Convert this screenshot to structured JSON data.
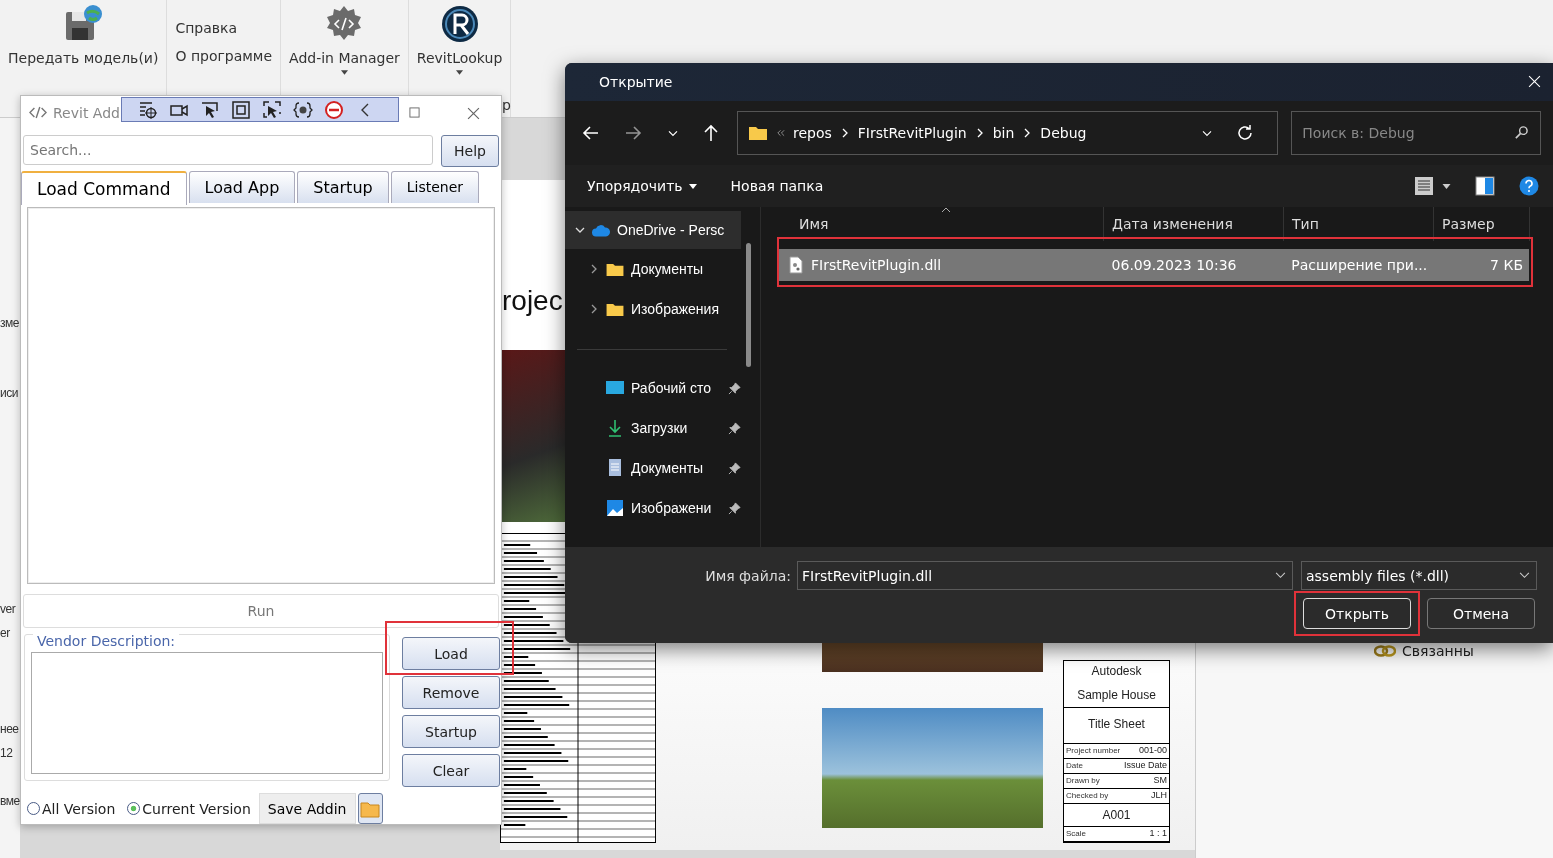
{
  "ribbon": [
    {
      "kind": "large",
      "label": "Передать модель(и)",
      "dropdown": false
    },
    {
      "kind": "stack",
      "labels": [
        "Справка",
        "О программе"
      ]
    },
    {
      "kind": "large",
      "label": "Add-in Manager",
      "dropdown": true
    },
    {
      "kind": "large",
      "label": "RevitLookup",
      "dropdown": true
    }
  ],
  "ribbon_fragment": "p",
  "left_panel_fragments": [
    "зме",
    "иси",
    "ver",
    "er",
    "нее",
    "12",
    "вме"
  ],
  "sheet": {
    "title_fragment": "rojec",
    "title_block": {
      "company": "Autodesk",
      "project": "Sample House",
      "sheet_name": "Title Sheet",
      "fields": [
        {
          "label": "Project number",
          "value": "001-00"
        },
        {
          "label": "Date",
          "value": "Issue Date"
        },
        {
          "label": "Drawn by",
          "value": "SM"
        },
        {
          "label": "Checked by",
          "value": "JLH"
        }
      ],
      "sheet_number": "A001",
      "scale_label": "Scale",
      "scale": "1 : 1"
    }
  },
  "project_browser": {
    "item": "Связанны"
  },
  "addin_window": {
    "title": "Revit Add",
    "search": {
      "placeholder": "Search..."
    },
    "help": "Help",
    "tabs": [
      {
        "label": "Load Command",
        "selected": true
      },
      {
        "label": "Load App",
        "selected": false
      },
      {
        "label": "Startup",
        "selected": false
      },
      {
        "label": "Listener",
        "selected": false
      }
    ],
    "run": "Run",
    "vendor_label": "Vendor Description:",
    "buttons": [
      {
        "label": "Load",
        "highlighted": true
      },
      {
        "label": "Remove",
        "highlighted": false
      },
      {
        "label": "Startup",
        "highlighted": false
      },
      {
        "label": "Clear",
        "highlighted": false
      }
    ],
    "radios": [
      {
        "label": "All Version",
        "selected": false
      },
      {
        "label": "Current Version",
        "selected": true
      }
    ],
    "save": "Save Addin"
  },
  "open_dialog": {
    "title": "Открытие",
    "breadcrumb": [
      "repos",
      "FIrstRevitPlugin",
      "bin",
      "Debug"
    ],
    "search": {
      "placeholder": "Поиск в: Debug"
    },
    "toolbar": [
      {
        "label": "Упорядочить",
        "dropdown": true
      },
      {
        "label": "Новая папка",
        "dropdown": false
      }
    ],
    "nav": [
      {
        "label": "OneDrive - Persc",
        "kind": "cloud",
        "selected": true,
        "expanded": true,
        "children": [
          {
            "label": "Документы",
            "kind": "folder",
            "selected": false,
            "expanded": false
          },
          {
            "label": "Изображения",
            "kind": "folder",
            "selected": false,
            "expanded": false
          }
        ]
      }
    ],
    "quick_access": [
      {
        "label": "Рабочий сто",
        "kind": "desktop",
        "pinned": true
      },
      {
        "label": "Загрузки",
        "kind": "download",
        "pinned": true
      },
      {
        "label": "Документы",
        "kind": "document",
        "pinned": true
      },
      {
        "label": "Изображени",
        "kind": "picture",
        "pinned": true
      }
    ],
    "columns": [
      "Имя",
      "Дата изменения",
      "Тип",
      "Размер"
    ],
    "files": [
      {
        "name": "FIrstRevitPlugin.dll",
        "modified": "06.09.2023 10:36",
        "type": "Расширение при...",
        "size": "7 КБ",
        "selected": true,
        "highlighted": true
      }
    ],
    "file_name_label": "Имя файла:",
    "file_name": "FIrstRevitPlugin.dll",
    "filter": "assembly files (*.dll)",
    "buttons": [
      {
        "label": "Открыть",
        "highlighted": true
      },
      {
        "label": "Отмена",
        "highlighted": false
      }
    ]
  }
}
